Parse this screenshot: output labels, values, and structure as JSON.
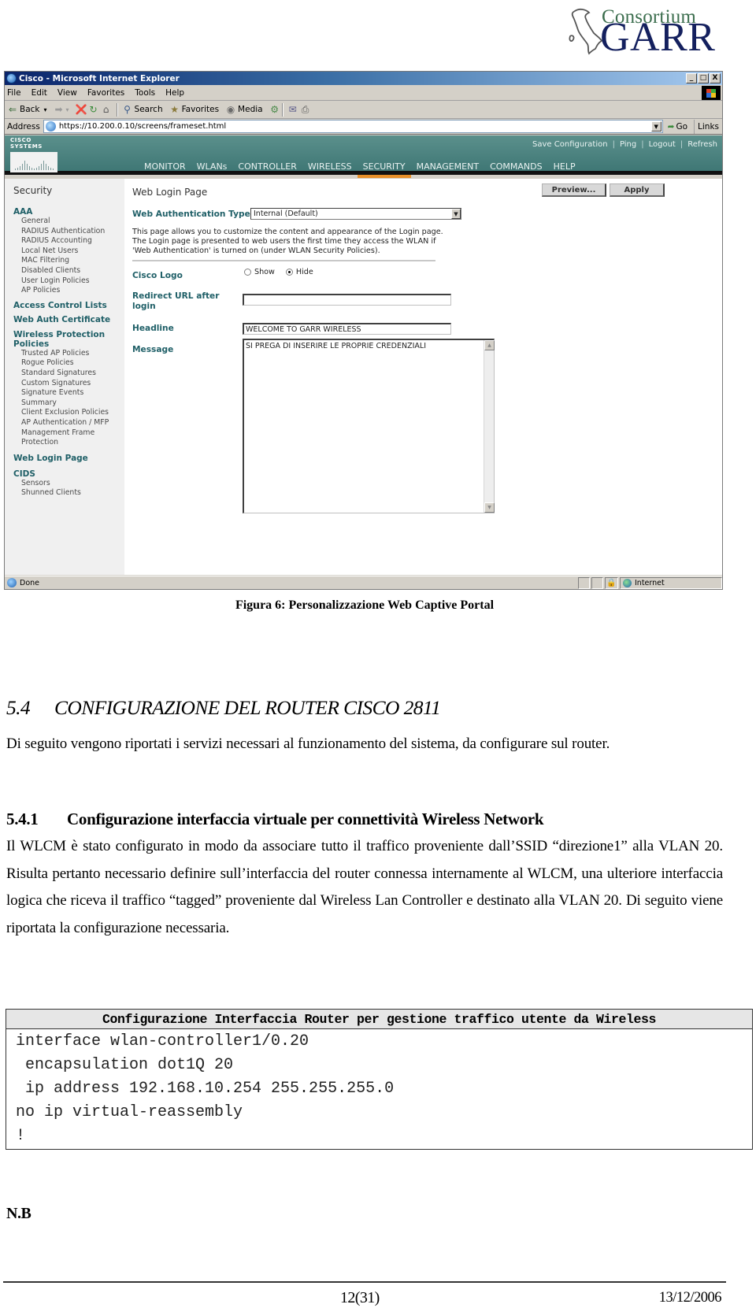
{
  "header_logo": {
    "line1": "Consortium",
    "line2": "GARR",
    "icon": "italy-map-icon"
  },
  "browser": {
    "window_title": "Cisco - Microsoft Internet Explorer",
    "window_buttons": [
      "_",
      "□",
      "X"
    ],
    "menu": [
      "File",
      "Edit",
      "View",
      "Favorites",
      "Tools",
      "Help"
    ],
    "toolbar": {
      "back": "Back",
      "search": "Search",
      "favorites": "Favorites",
      "media": "Media"
    },
    "address": {
      "label": "Address",
      "url": "https://10.200.0.10/screens/frameset.html",
      "go": "Go",
      "links": "Links"
    },
    "status": {
      "text": "Done",
      "zone": "Internet"
    }
  },
  "cisco": {
    "brand": "CISCO SYSTEMS",
    "top_links": [
      "Save Configuration",
      "Ping",
      "Logout",
      "Refresh"
    ],
    "nav": [
      "MONITOR",
      "WLANs",
      "CONTROLLER",
      "WIRELESS",
      "SECURITY",
      "MANAGEMENT",
      "COMMANDS",
      "HELP"
    ],
    "active_nav": "SECURITY",
    "accent_color": "#e8902a",
    "sidebar": {
      "title": "Security",
      "groups": [
        {
          "label": "AAA",
          "items": [
            "General",
            "RADIUS Authentication",
            "RADIUS Accounting",
            "Local Net Users",
            "MAC Filtering",
            "Disabled Clients",
            "User Login Policies",
            "AP Policies"
          ]
        },
        {
          "label": "Access Control Lists",
          "items": []
        },
        {
          "label": "Web Auth Certificate",
          "items": []
        },
        {
          "label": "Wireless Protection Policies",
          "items": [
            "Trusted AP Policies",
            "Rogue Policies",
            "Standard Signatures",
            "Custom Signatures",
            "Signature Events Summary",
            "Client Exclusion Policies",
            "AP Authentication / MFP",
            "Management Frame Protection"
          ]
        },
        {
          "label": "Web Login Page",
          "items": []
        },
        {
          "label": "CIDS",
          "items": [
            "Sensors",
            "Shunned Clients"
          ]
        }
      ]
    },
    "page": {
      "title": "Web Login Page",
      "preview_button": "Preview...",
      "apply_button": "Apply",
      "web_auth_type_label": "Web Authentication Type",
      "web_auth_type_value": "Internal (Default)",
      "description": "This page allows you to customize the content and appearance of the Login page. The Login page is presented to web users the first time they access the WLAN if 'Web Authentication' is turned on (under WLAN Security Policies).",
      "cisco_logo_label": "Cisco Logo",
      "cisco_logo_options": [
        "Show",
        "Hide"
      ],
      "cisco_logo_selected": "Hide",
      "redirect_label": "Redirect URL after login",
      "redirect_value": "",
      "headline_label": "Headline",
      "headline_value": "WELCOME TO GARR WIRELESS",
      "message_label": "Message",
      "message_value": "SI PREGA DI INSERIRE LE PROPRIE CREDENZIALI"
    }
  },
  "document": {
    "figure_caption": "Figura 6: Personalizzazione Web Captive Portal",
    "section": {
      "number": "5.4",
      "title": "CONFIGURAZIONE DEL ROUTER CISCO 2811"
    },
    "section_intro": "Di seguito vengono riportati i servizi necessari al funzionamento del sistema, da configurare sul router.",
    "subsection": {
      "number": "5.4.1",
      "title": "Configurazione interfaccia virtuale per connettività Wireless Network"
    },
    "subsection_body": "Il WLCM è stato configurato in modo da associare tutto il traffico proveniente dall’SSID “direzione1” alla VLAN 20. Risulta pertanto necessario definire sull’interfaccia del router connessa internamente al WLCM, una ulteriore interfaccia logica che riceva il traffico “tagged” proveniente dal Wireless Lan Controller e destinato alla VLAN 20. Di seguito viene riportata la configurazione necessaria.",
    "code_block": {
      "title": "Configurazione Interfaccia Router per gestione traffico utente da Wireless",
      "lines": [
        "interface wlan-controller1/0.20",
        " encapsulation dot1Q 20",
        " ip address 192.168.10.254 255.255.255.0",
        "no ip virtual-reassembly",
        "!"
      ]
    },
    "note": "N.B",
    "footer": {
      "page": "12(31)",
      "date": "13/12/2006"
    }
  }
}
